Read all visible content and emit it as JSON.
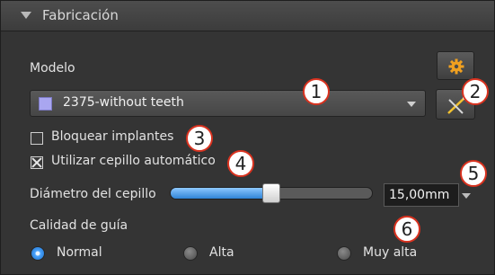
{
  "panel": {
    "title": "Fabricación"
  },
  "model": {
    "label": "Modelo",
    "selected": "2375-without teeth",
    "swatch_color": "#a9a6f0"
  },
  "options": {
    "lock_implants": {
      "label": "Bloquear implantes",
      "checked": false
    },
    "auto_brush": {
      "label": "Utilizar cepillo automático",
      "checked": true
    }
  },
  "brush": {
    "label": "Diámetro del cepillo",
    "value_text": "15,00mm",
    "slider_fraction": 0.5
  },
  "guide_quality": {
    "label": "Calidad de guía",
    "options": [
      "Normal",
      "Alta",
      "Muy alta"
    ],
    "selected": "Normal"
  },
  "annotations": [
    "1",
    "2",
    "3",
    "4",
    "5",
    "6"
  ],
  "icons": {
    "settings": "gear-icon",
    "tool": "wand-tool-icon",
    "collapse": "collapse-triangle-icon"
  },
  "colors": {
    "accent": "#3a93ec",
    "settings_icon": "#f0a020",
    "annotation_ring": "#d9321f"
  }
}
